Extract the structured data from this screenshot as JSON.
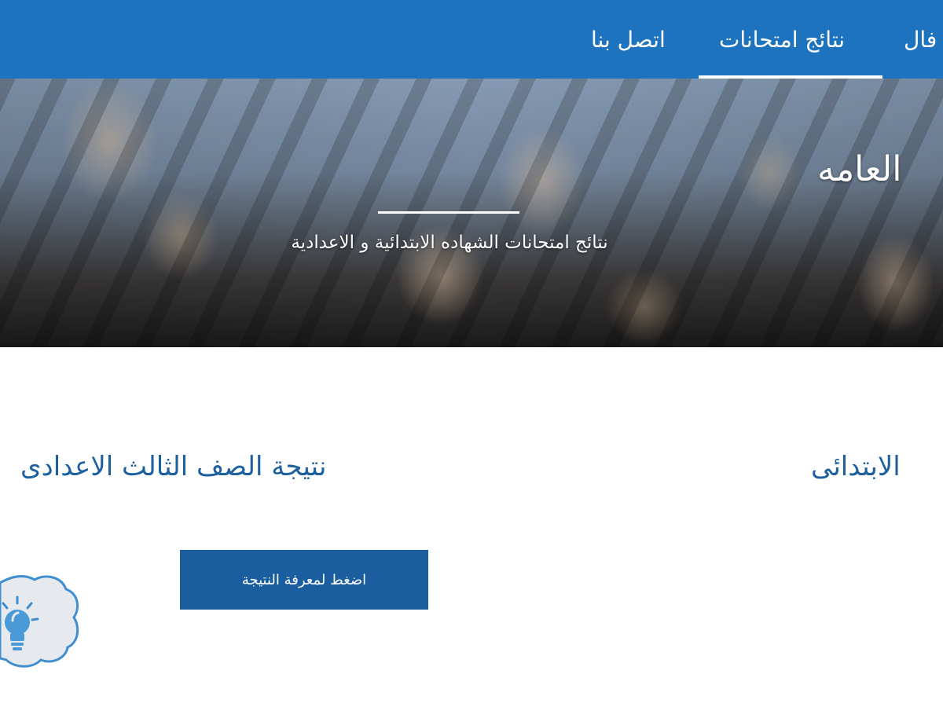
{
  "nav": {
    "items": [
      {
        "label": "اتصل بنا"
      },
      {
        "label": "نتائج امتحانات"
      },
      {
        "label": "فال"
      }
    ],
    "active_index": 1
  },
  "hero": {
    "heading": "العامه",
    "subtitle": "نتائج امتحانات الشهاده الابتدائية و الاعدادية"
  },
  "sections": {
    "prep": {
      "title": "نتيجة الصف الثالث الاعدادى",
      "button_label": "اضغط لمعرفة النتيجة"
    },
    "primary": {
      "title": "الابتدائى"
    }
  },
  "badge": {
    "icon": "lightbulb-icon"
  },
  "colors": {
    "nav_bg": "#1e73be",
    "button_bg": "#1a5ea0",
    "title_text": "#1e5f9e",
    "badge_fill": "#e6e9ee",
    "badge_stroke": "#3f8fd0"
  }
}
